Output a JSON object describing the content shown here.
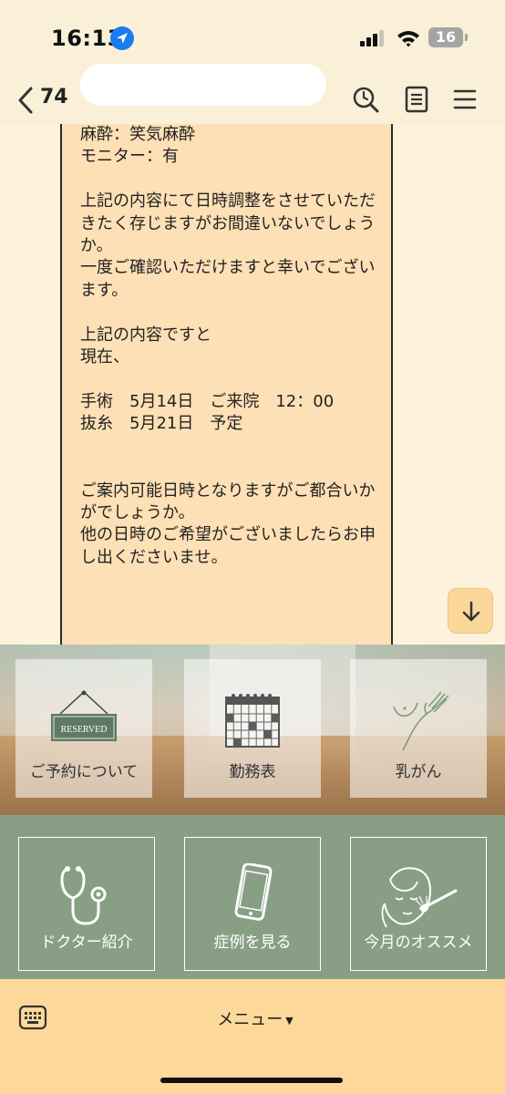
{
  "status_bar": {
    "time": "16:13",
    "battery": "16",
    "icons": [
      "location-arrow-icon",
      "cellular-signal-icon",
      "wifi-icon",
      "battery-icon"
    ]
  },
  "header": {
    "unread_count": "74",
    "icons": [
      "back-chevron-icon",
      "search-icon",
      "notes-icon",
      "hamburger-menu-icon"
    ]
  },
  "message": {
    "text": "麻酔：笑気麻酔\nモニター：有\n\n上記の内容にて日時調整をさせていただきたく存じますがお間違いないでしょうか。\n一度ご確認いただけますと幸いでございます。\n\n上記の内容ですと\n現在、\n\n手術　5月14日　ご来院　12：00\n抜糸　5月21日　予定\n\n\nご案内可能日時となりますがご都合いかがでしょうか。\n他の日時のご希望がございましたらお申し出くださいませ。"
  },
  "scroll_button": {
    "icon": "arrow-down-icon"
  },
  "rich_menu": {
    "top_tiles": [
      {
        "label": "ご予約について",
        "icon": "reserved-sign-icon",
        "sign_text": "RESERVED"
      },
      {
        "label": "勤務表",
        "icon": "calendar-icon"
      },
      {
        "label": "乳がん",
        "icon": "breast-check-icon"
      }
    ],
    "bottom_tiles": [
      {
        "label": "ドクター紹介",
        "icon": "stethoscope-icon"
      },
      {
        "label": "症例を見る",
        "icon": "smartphone-icon"
      },
      {
        "label": "今月のオススメ",
        "icon": "face-beauty-icon"
      }
    ],
    "colors": {
      "green": "#889f86",
      "bar": "#fcd99a",
      "bubble": "#fde0b6"
    }
  },
  "bottom_bar": {
    "menu_label": "メニュー",
    "icon": "keyboard-icon"
  }
}
